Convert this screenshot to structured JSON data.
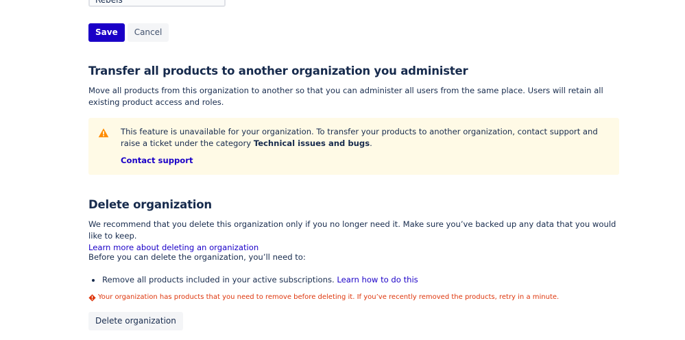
{
  "org_name_input": {
    "value": "Rebels"
  },
  "actions": {
    "save_label": "Save",
    "cancel_label": "Cancel"
  },
  "transfer": {
    "title": "Transfer all products to another organization you administer",
    "description": "Move all products from this organization to another so that you can administer all users from the same place. Users will retain all existing product access and roles.",
    "warning": {
      "icon": "warning-icon",
      "text_before": "This feature is unavailable for your organization. To transfer your products to another organization, contact support and raise a ticket under the category ",
      "category": "Technical issues and bugs",
      "text_after": ".",
      "link": "Contact support"
    }
  },
  "delete": {
    "title": "Delete organization",
    "description": "We recommend that you delete this organization only if you no longer need it. Make sure you’ve backed up any data that you would like to keep.",
    "learn_more": "Learn more about deleting an organization",
    "prereq_intro": "Before you can delete the organization, you’ll need to:",
    "prereq_item": "Remove all products included in your active subscriptions.",
    "prereq_link": "Learn how to do this",
    "error_icon": "error-icon",
    "error_text": "Your organization has products that you need to remove before deleting it. If you’ve recently removed the products, retry in a minute.",
    "button": "Delete organization"
  },
  "colors": {
    "primary": "#1a00c7",
    "text": "#172b4d",
    "warning_bg": "#fffae6",
    "warning_icon": "#ff8b00",
    "error": "#de350b"
  }
}
